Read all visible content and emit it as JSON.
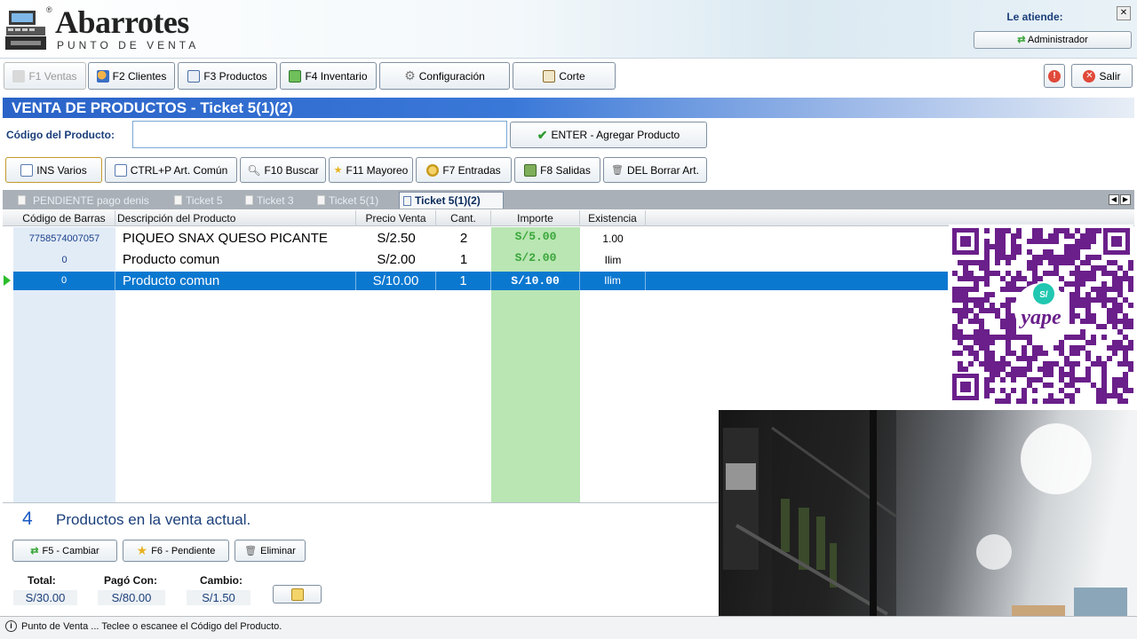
{
  "header": {
    "logo_title": "Abarrotes",
    "logo_subtitle": "PUNTO DE VENTA",
    "logo_reg": "®",
    "attends_label": "Le atiende:",
    "attends_user": "Administrador",
    "close_glyph": "✕"
  },
  "toolbar": {
    "ventas": "F1 Ventas",
    "clientes": "F2 Clientes",
    "productos": "F3 Productos",
    "inventario": "F4 Inventario",
    "configuracion": "Configuración",
    "corte": "Corte",
    "salir": "Salir"
  },
  "sale": {
    "title": "VENTA DE PRODUCTOS - Ticket 5(1)(2)",
    "code_label": "Código del Producto:",
    "code_value": "",
    "add_button": "ENTER - Agregar Producto"
  },
  "actions": {
    "ins_varios": "INS Varios",
    "art_comun": "CTRL+P Art. Común",
    "buscar": "F10 Buscar",
    "mayoreo": "F11 Mayoreo",
    "entradas": "F7 Entradas",
    "salidas": "F8 Salidas",
    "borrar": "DEL Borrar Art."
  },
  "tabs": [
    {
      "label": "PENDIENTE pago denis"
    },
    {
      "label": "Ticket 5"
    },
    {
      "label": "Ticket 3"
    },
    {
      "label": "Ticket 5(1)"
    },
    {
      "label": "Ticket 5(1)(2)"
    }
  ],
  "grid": {
    "columns": [
      "Código de Barras",
      "Descripción del Producto",
      "Precio Venta",
      "Cant.",
      "Importe",
      "Existencia"
    ],
    "rows": [
      {
        "barcode": "7758574007057",
        "description": "PIQUEO SNAX QUESO PICANTE",
        "price": "S/2.50",
        "qty": "2",
        "amount": "S/5.00",
        "stock": "1.00"
      },
      {
        "barcode": "0",
        "description": "Producto comun",
        "price": "S/2.00",
        "qty": "1",
        "amount": "S/2.00",
        "stock": "Ilim"
      },
      {
        "barcode": "0",
        "description": "Producto comun",
        "price": "S/10.00",
        "qty": "1",
        "amount": "S/10.00",
        "stock": "Ilim"
      }
    ]
  },
  "footer": {
    "product_count": "4",
    "product_count_label": "Productos en la venta actual.",
    "cambiar": "F5 - Cambiar",
    "pendiente": "F6 - Pendiente",
    "eliminar": "Eliminar",
    "total_label": "Total:",
    "total_value": "S/30.00",
    "paid_label": "Pagó Con:",
    "paid_value": "S/80.00",
    "change_label": "Cambio:",
    "change_value": "S/1.50"
  },
  "status": {
    "text": "Punto de Venta ... Teclee o escanee el Código del Producto."
  },
  "qr": {
    "badge": "S/",
    "brand": "yape"
  },
  "colors": {
    "title_blue": "#2a63c8",
    "selection": "#0b78d0",
    "import_green": "#b9e6b3",
    "qr_purple": "#6a1f8a"
  },
  "icons": [
    "register-icon",
    "clients-icon",
    "products-icon",
    "inventory-icon",
    "gear-icon",
    "cut-icon",
    "alert-icon",
    "exit-icon",
    "document-icon",
    "search-icon",
    "star-icon",
    "coins-icon",
    "trash-icon",
    "check-icon",
    "info-icon",
    "cash-icon"
  ]
}
